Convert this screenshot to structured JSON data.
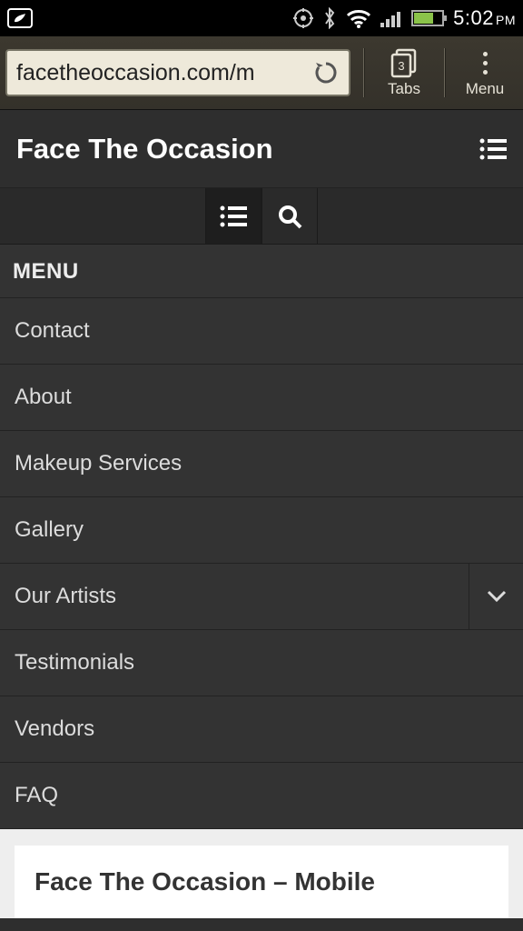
{
  "status": {
    "time": "5:02",
    "ampm": "PM"
  },
  "browser": {
    "url": "facetheoccasion.com/m",
    "tabs_label": "Tabs",
    "tabs_count": "3",
    "menu_label": "Menu"
  },
  "site": {
    "title": "Face The Occasion"
  },
  "menu": {
    "heading": "MENU",
    "items": [
      {
        "label": "Contact",
        "expandable": false
      },
      {
        "label": "About",
        "expandable": false
      },
      {
        "label": "Makeup Services",
        "expandable": false
      },
      {
        "label": "Gallery",
        "expandable": false
      },
      {
        "label": "Our Artists",
        "expandable": true
      },
      {
        "label": "Testimonials",
        "expandable": false
      },
      {
        "label": "Vendors",
        "expandable": false
      },
      {
        "label": "FAQ",
        "expandable": false
      }
    ]
  },
  "content": {
    "title": "Face The Occasion – Mobile"
  }
}
